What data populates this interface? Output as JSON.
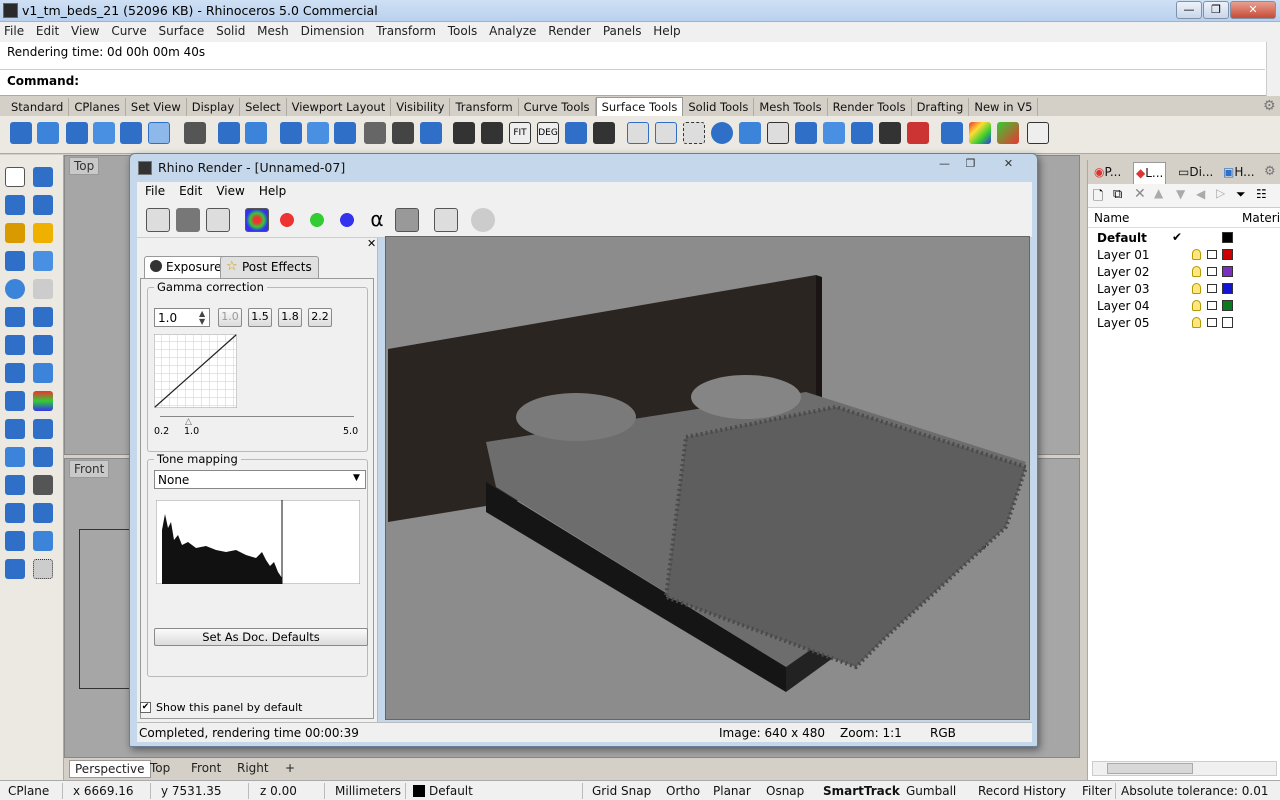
{
  "window": {
    "title": "v1_tm_beds_21 (52096 KB) - Rhinoceros 5.0 Commercial"
  },
  "menu": [
    "File",
    "Edit",
    "View",
    "Curve",
    "Surface",
    "Solid",
    "Mesh",
    "Dimension",
    "Transform",
    "Tools",
    "Analyze",
    "Render",
    "Panels",
    "Help"
  ],
  "command": {
    "history": "Rendering time: 0d 00h 00m 40s",
    "prompt": "Command:"
  },
  "toolbar_tabs": [
    "Standard",
    "CPlanes",
    "Set View",
    "Display",
    "Select",
    "Viewport Layout",
    "Visibility",
    "Transform",
    "Curve Tools",
    "Surface Tools",
    "Solid Tools",
    "Mesh Tools",
    "Render Tools",
    "Drafting",
    "New in V5"
  ],
  "active_toolbar_tab": "Surface Tools",
  "viewports": {
    "top_label": "Top",
    "front_label": "Front",
    "bg_label": "Perspective"
  },
  "viewport_tabs": [
    "Perspective",
    "Top",
    "Front",
    "Right"
  ],
  "status": {
    "cplane": "CPlane",
    "x": "x 6669.16",
    "y": "y 7531.35",
    "z": "z 0.00",
    "units": "Millimeters",
    "layer": "Default",
    "toggles": [
      "Grid Snap",
      "Ortho",
      "Planar",
      "Osnap",
      "SmartTrack",
      "Gumball",
      "Record History",
      "Filter"
    ],
    "tolerance": "Absolute tolerance: 0.01"
  },
  "panel": {
    "tabs": [
      "P...",
      "L...",
      "Di...",
      "H..."
    ],
    "col_name": "Name",
    "col_material": "Material",
    "layers": [
      {
        "name": "Default",
        "color": "#000000",
        "current": true,
        "check": "✔"
      },
      {
        "name": "Layer 01",
        "color": "#cc0000"
      },
      {
        "name": "Layer 02",
        "color": "#7b2fbf"
      },
      {
        "name": "Layer 03",
        "color": "#1414d6"
      },
      {
        "name": "Layer 04",
        "color": "#0a7a1e"
      },
      {
        "name": "Layer 05",
        "color": "#ffffff"
      }
    ]
  },
  "render": {
    "title": "Rhino Render - [Unnamed-07]",
    "menu": [
      "File",
      "Edit",
      "View",
      "Help"
    ],
    "tabs": {
      "exposure": "Exposure",
      "post": "Post Effects"
    },
    "gamma": {
      "title": "Gamma correction",
      "value": "1.0",
      "presets": [
        "1.0",
        "1.5",
        "1.8",
        "2.2"
      ],
      "min": "0.2",
      "mark": "1.0",
      "max": "5.0"
    },
    "tone": {
      "title": "Tone mapping",
      "selected": "None"
    },
    "defaults_btn": "Set As Doc. Defaults",
    "show_panel": "Show this panel by default",
    "status": {
      "completed": "Completed, rendering time 00:00:39",
      "image": "Image: 640 x 480",
      "zoom": "Zoom: 1:1",
      "mode": "RGB"
    }
  }
}
